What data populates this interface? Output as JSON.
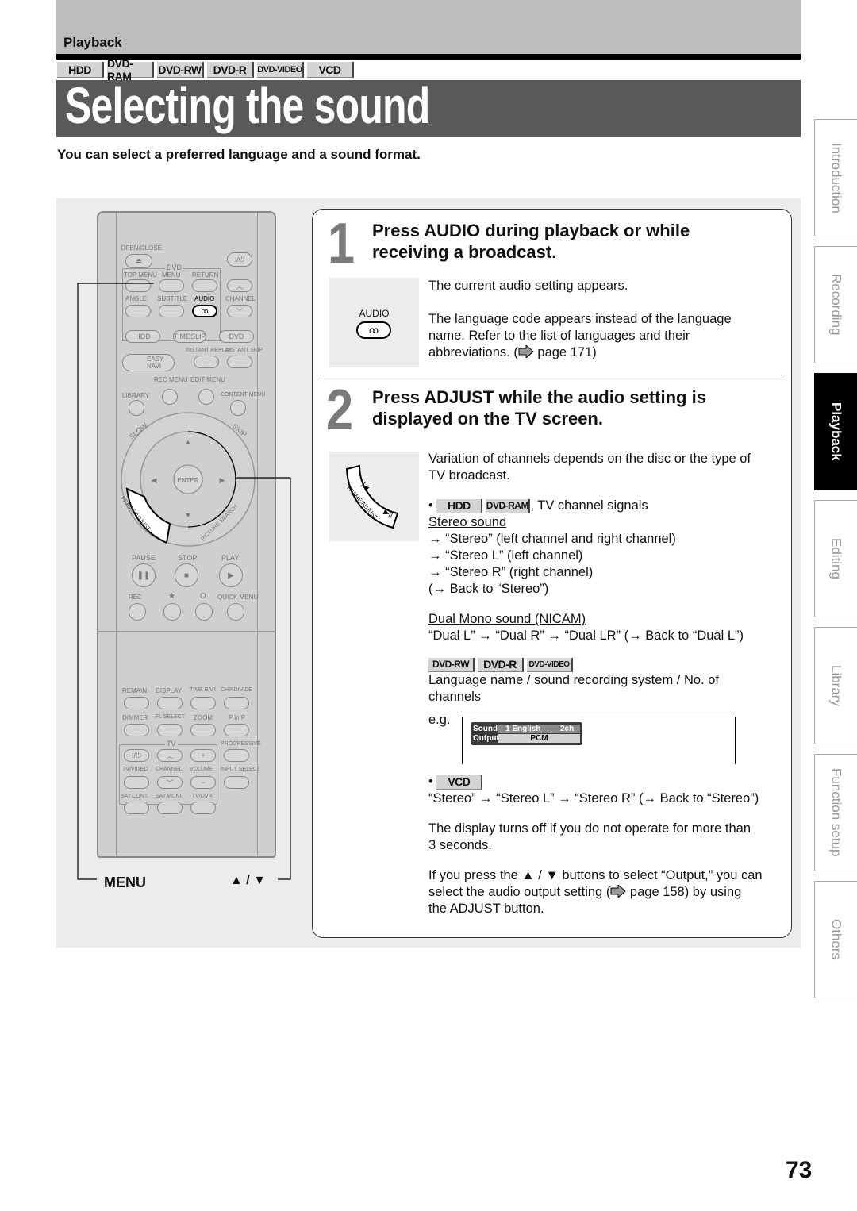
{
  "header": {
    "section": "Playback",
    "media_badges": [
      "HDD",
      "DVD-RAM",
      "DVD-RW",
      "DVD-R",
      "DVD-VIDEO",
      "VCD"
    ],
    "title": "Selecting the sound",
    "subtitle": "You can select a preferred language and a sound format."
  },
  "side_tabs": [
    {
      "label": "Introduction",
      "active": false
    },
    {
      "label": "Recording",
      "active": false
    },
    {
      "label": "Playback",
      "active": true
    },
    {
      "label": "Editing",
      "active": false
    },
    {
      "label": "Library",
      "active": false
    },
    {
      "label": "Function setup",
      "active": false
    },
    {
      "label": "Others",
      "active": false
    }
  ],
  "remote": {
    "labels": {
      "open_close": "OPEN/CLOSE",
      "dvd": "DVD",
      "top_menu": "TOP MENU",
      "menu": "MENU",
      "return": "RETURN",
      "angle": "ANGLE",
      "subtitle": "SUBTITLE",
      "audio": "AUDIO",
      "channel": "CHANNEL",
      "hdd": "HDD",
      "timeslip": "TIMESLIP",
      "dvd_btn": "DVD",
      "instant_replay": "INSTANT REPLAY",
      "instant_skip": "INSTANT SKIP",
      "easy_navi": "EASY NAVI",
      "rec_menu": "REC MENU",
      "edit_menu": "EDIT MENU",
      "library": "LIBRARY",
      "content_menu": "CONTENT MENU",
      "slow": "SLOW",
      "skip": "SKIP",
      "enter": "ENTER",
      "frame_adjust": "FRAME/ADJUST",
      "picture_search": "PICTURE SEARCH",
      "pause": "PAUSE",
      "stop": "STOP",
      "play": "PLAY",
      "rec": "REC",
      "star": "★",
      "circle": "O",
      "quick_menu": "QUICK MENU",
      "remain": "REMAIN",
      "display": "DISPLAY",
      "time_bar": "TIME BAR",
      "chp_divide": "CHP DIVIDE",
      "dimmer": "DIMMER",
      "fl_select": "FL SELECT",
      "zoom": "ZOOM",
      "p_in_p": "P in P",
      "tv": "TV",
      "progressive": "PROGRESSIVE",
      "tv_video": "TV/VIDEO",
      "channel2": "CHANNEL",
      "volume": "VOLUME",
      "input_select": "INPUT SELECT",
      "sat_cont": "SAT.CONT.",
      "sat_moni": "SAT.MONI.",
      "tv_dvr": "TV/DVR"
    },
    "callout_menu": "MENU",
    "callout_updown": "▲ / ▼"
  },
  "step1": {
    "number": "1",
    "heading_line1": "Press AUDIO during playback or while",
    "heading_line2": "receiving a broadcast.",
    "icon_label": "AUDIO",
    "p1": "The current audio setting appears.",
    "p2a": "The language code appears instead of the language",
    "p2b": "name. Refer to the list of languages and their",
    "p2c_pre": "abbreviations. (",
    "p2c_post": " page 171)"
  },
  "step2": {
    "number": "2",
    "heading_line1": "Press ADJUST while the audio setting is",
    "heading_line2": "displayed on the TV screen.",
    "icon_label": "FRAME/ADJUST",
    "p1a": "Variation of channels depends on the disc or the type of",
    "p1b": "TV broadcast.",
    "hdd_badges": [
      "HDD",
      "DVD-RAM"
    ],
    "hdd_suffix": ", TV channel signals",
    "stereo_heading": "Stereo sound",
    "stereo_lines": [
      "→ “Stereo” (left channel and right channel)",
      "→ “Stereo L” (left channel)",
      "→ “Stereo R” (right channel)",
      "(→ Back to “Stereo”)"
    ],
    "dual_heading": "Dual Mono sound (NICAM)",
    "dual_line": "“Dual L” → “Dual R” → “Dual LR” (→ Back to “Dual L”)",
    "dvd_badges": [
      "DVD-RW",
      "DVD-R",
      "DVD-VIDEO"
    ],
    "dvd_line1": "Language name / sound recording system / No. of",
    "dvd_line2": "channels",
    "eg": "e.g.",
    "osd": {
      "sound_label": "Sound",
      "sound_value": "1  English",
      "channels": "2ch",
      "output_label": "Output",
      "output_value": "PCM"
    },
    "vcd_badge": "VCD",
    "vcd_line": "“Stereo” → “Stereo L” → “Stereo R” (→ Back to “Stereo”)",
    "display_off_a": "The display turns off if you do not operate for more than",
    "display_off_b": "3 seconds.",
    "output_a": "If you press the ▲ / ▼ buttons to select “Output,” you can",
    "output_b_pre": "select the audio output setting (",
    "output_b_post": " page 158) by using",
    "output_c": "the ADJUST button."
  },
  "page_number": "73"
}
